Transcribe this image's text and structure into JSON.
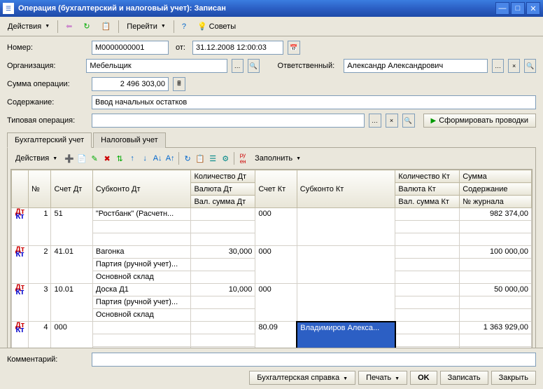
{
  "window": {
    "title": "Операция (бухгалтерский и налоговый учет): Записан"
  },
  "toolbar": {
    "actions": "Действия",
    "goto": "Перейти",
    "tips": "Советы"
  },
  "form": {
    "number_label": "Номер:",
    "number": "М0000000001",
    "from_label": "от:",
    "date": "31.12.2008 12:00:03",
    "org_label": "Организация:",
    "org": "Мебельщик",
    "resp_label": "Ответственный:",
    "resp": "Александр Александрович",
    "sum_label": "Сумма операции:",
    "sum": "2 496 303,00",
    "content_label": "Содержание:",
    "content": "Ввод начальных остатков",
    "typop_label": "Типовая операция:",
    "typop": "",
    "form_btn": "Сформировать проводки"
  },
  "tabs": {
    "acc": "Бухгалтерский учет",
    "tax": "Налоговый учет"
  },
  "inner": {
    "actions": "Действия",
    "fill": "Заполнить"
  },
  "headers": {
    "num": "№",
    "acc_dt": "Счет Дт",
    "sub_dt": "Субконто Дт",
    "qty_dt": "Количество Дт",
    "acc_kt": "Счет Кт",
    "sub_kt": "Субконто Кт",
    "qty_kt": "Количество Кт",
    "sum": "Сумма",
    "cur_dt": "Валюта Дт",
    "cur_kt": "Валюта Кт",
    "cont": "Содержание",
    "vsum_dt": "Вал. сумма Дт",
    "vsum_kt": "Вал. сумма Кт",
    "journal": "№ журнала"
  },
  "rows": [
    {
      "n": "1",
      "acc_dt": "51",
      "sub": [
        "\"Ростбанк\" (Расчетн...",
        "",
        ""
      ],
      "qty_dt": "",
      "acc_kt": "000",
      "sub_kt": "",
      "qty_kt": "",
      "sum": "982 374,00"
    },
    {
      "n": "2",
      "acc_dt": "41.01",
      "sub": [
        "Вагонка",
        "Партия (ручной учет)...",
        "Основной склад"
      ],
      "qty_dt": "30,000",
      "acc_kt": "000",
      "sub_kt": "",
      "qty_kt": "",
      "sum": "100 000,00"
    },
    {
      "n": "3",
      "acc_dt": "10.01",
      "sub": [
        "Доска Д1",
        "Партия (ручной учет)...",
        "Основной склад"
      ],
      "qty_dt": "10,000",
      "acc_kt": "000",
      "sub_kt": "",
      "qty_kt": "",
      "sum": "50 000,00"
    },
    {
      "n": "4",
      "acc_dt": "000",
      "sub": [
        "",
        "",
        ""
      ],
      "qty_dt": "",
      "acc_kt": "80.09",
      "sub_kt": "Владимиров Алекса...",
      "qty_kt": "",
      "sum": "1 363 929,00",
      "sel": true
    }
  ],
  "comment_label": "Комментарий:",
  "comment": "",
  "footer": {
    "ref": "Бухгалтерская справка",
    "print": "Печать",
    "ok": "OK",
    "save": "Записать",
    "close": "Закрыть"
  }
}
